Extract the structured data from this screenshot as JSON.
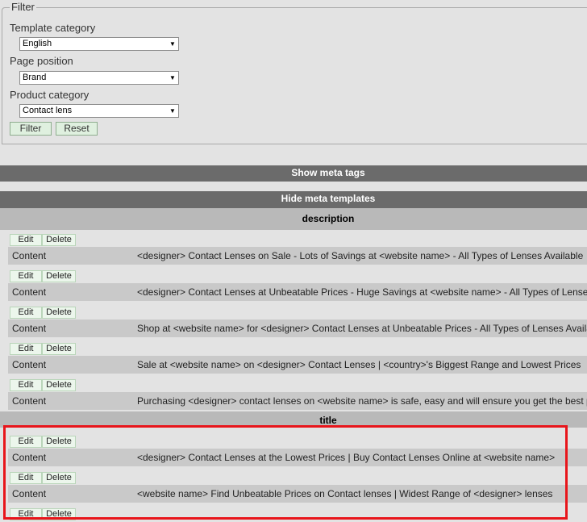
{
  "filter": {
    "legend": "Filter",
    "template_category": {
      "label": "Template category",
      "value": "English"
    },
    "page_position": {
      "label": "Page position",
      "value": "Brand"
    },
    "product_category": {
      "label": "Product category",
      "value": "Contact lens"
    },
    "filter_label": "Filter",
    "reset_label": "Reset"
  },
  "show_meta_tags": "Show meta tags",
  "hide_meta_templates": "Hide meta templates",
  "sections": {
    "description": {
      "title": "description",
      "rows": [
        {
          "edit": "Edit",
          "delete": "Delete",
          "label": "Content",
          "value": "<designer> Contact Lenses on Sale - Lots of Savings at <website name> - All Types of Lenses Available"
        },
        {
          "edit": "Edit",
          "delete": "Delete",
          "label": "Content",
          "value": "<designer> Contact Lenses at Unbeatable Prices - Huge Savings at <website name> - All Types of Lenses"
        },
        {
          "edit": "Edit",
          "delete": "Delete",
          "label": "Content",
          "value": "Shop at <website name> for <designer> Contact Lenses at Unbeatable Prices - All Types of Lenses Available"
        },
        {
          "edit": "Edit",
          "delete": "Delete",
          "label": "Content",
          "value": "Sale at <website name> on <designer> Contact Lenses | <country>'s Biggest Range and Lowest Prices"
        },
        {
          "edit": "Edit",
          "delete": "Delete",
          "label": "Content",
          "value": "Purchasing <designer> contact lenses on <website name> is safe, easy and will ensure you get the best p"
        }
      ]
    },
    "title": {
      "title": "title",
      "rows": [
        {
          "edit": "Edit",
          "delete": "Delete",
          "label": "Content",
          "value": "<designer> Contact Lenses at the Lowest Prices | Buy Contact Lenses Online at <website name>"
        },
        {
          "edit": "Edit",
          "delete": "Delete",
          "label": "Content",
          "value": "<website name> Find Unbeatable Prices on Contact lenses | Widest Range of <designer> lenses"
        }
      ],
      "last_edit": "Edit",
      "last_delete": "Delete"
    }
  },
  "colors": {
    "highlight": "#e8151b",
    "bar": "#6b6b6b",
    "button_bg": "#dff0df"
  }
}
